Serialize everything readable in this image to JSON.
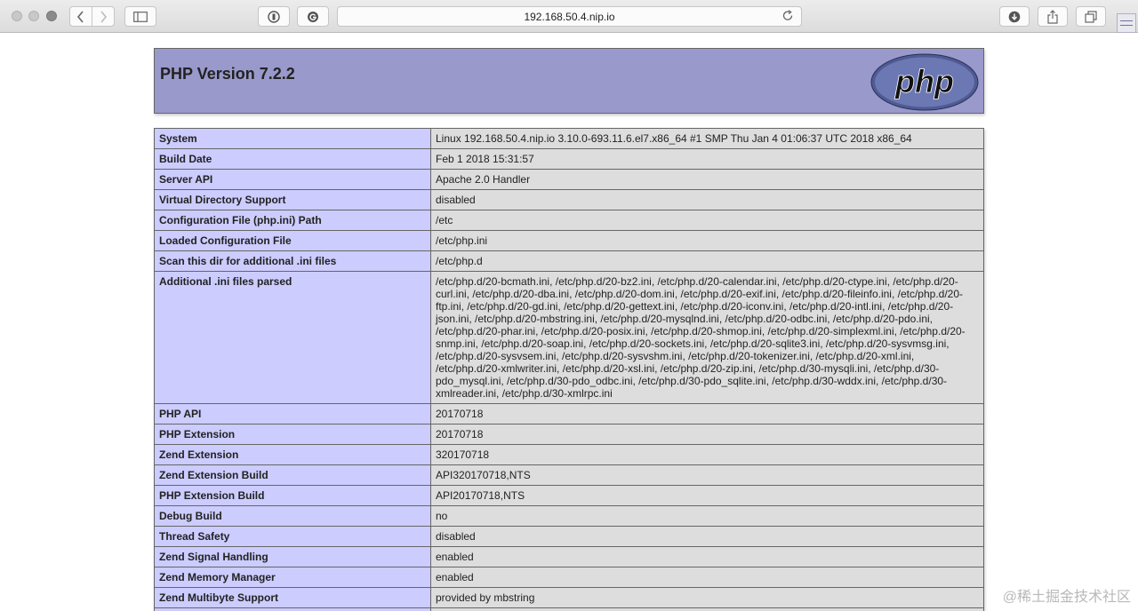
{
  "browser": {
    "url": "192.168.50.4.nip.io",
    "icons": [
      "back-icon",
      "forward-icon",
      "sidebar-icon",
      "reader-icon",
      "extension-icon",
      "reload-icon",
      "download-icon",
      "share-icon",
      "tabs-icon"
    ]
  },
  "page": {
    "title": "PHP Version 7.2.2",
    "logo_text": "php",
    "colors": {
      "header": "#9999cc",
      "label_cell": "#ccccff",
      "value_cell": "#dddddd"
    },
    "rows": [
      {
        "label": "System",
        "value": "Linux 192.168.50.4.nip.io 3.10.0-693.11.6.el7.x86_64 #1 SMP Thu Jan 4 01:06:37 UTC 2018 x86_64"
      },
      {
        "label": "Build Date",
        "value": "Feb 1 2018 15:31:57"
      },
      {
        "label": "Server API",
        "value": "Apache 2.0 Handler"
      },
      {
        "label": "Virtual Directory Support",
        "value": "disabled"
      },
      {
        "label": "Configuration File (php.ini) Path",
        "value": "/etc"
      },
      {
        "label": "Loaded Configuration File",
        "value": "/etc/php.ini"
      },
      {
        "label": "Scan this dir for additional .ini files",
        "value": "/etc/php.d"
      },
      {
        "label": "Additional .ini files parsed",
        "value": "/etc/php.d/20-bcmath.ini, /etc/php.d/20-bz2.ini, /etc/php.d/20-calendar.ini, /etc/php.d/20-ctype.ini, /etc/php.d/20-curl.ini, /etc/php.d/20-dba.ini, /etc/php.d/20-dom.ini, /etc/php.d/20-exif.ini, /etc/php.d/20-fileinfo.ini, /etc/php.d/20-ftp.ini, /etc/php.d/20-gd.ini, /etc/php.d/20-gettext.ini, /etc/php.d/20-iconv.ini, /etc/php.d/20-intl.ini, /etc/php.d/20-json.ini, /etc/php.d/20-mbstring.ini, /etc/php.d/20-mysqlnd.ini, /etc/php.d/20-odbc.ini, /etc/php.d/20-pdo.ini, /etc/php.d/20-phar.ini, /etc/php.d/20-posix.ini, /etc/php.d/20-shmop.ini, /etc/php.d/20-simplexml.ini, /etc/php.d/20-snmp.ini, /etc/php.d/20-soap.ini, /etc/php.d/20-sockets.ini, /etc/php.d/20-sqlite3.ini, /etc/php.d/20-sysvmsg.ini, /etc/php.d/20-sysvsem.ini, /etc/php.d/20-sysvshm.ini, /etc/php.d/20-tokenizer.ini, /etc/php.d/20-xml.ini, /etc/php.d/20-xmlwriter.ini, /etc/php.d/20-xsl.ini, /etc/php.d/20-zip.ini, /etc/php.d/30-mysqli.ini, /etc/php.d/30-pdo_mysql.ini, /etc/php.d/30-pdo_odbc.ini, /etc/php.d/30-pdo_sqlite.ini, /etc/php.d/30-wddx.ini, /etc/php.d/30-xmlreader.ini, /etc/php.d/30-xmlrpc.ini"
      },
      {
        "label": "PHP API",
        "value": "20170718"
      },
      {
        "label": "PHP Extension",
        "value": "20170718"
      },
      {
        "label": "Zend Extension",
        "value": "320170718"
      },
      {
        "label": "Zend Extension Build",
        "value": "API320170718,NTS"
      },
      {
        "label": "PHP Extension Build",
        "value": "API20170718,NTS"
      },
      {
        "label": "Debug Build",
        "value": "no"
      },
      {
        "label": "Thread Safety",
        "value": "disabled"
      },
      {
        "label": "Zend Signal Handling",
        "value": "enabled"
      },
      {
        "label": "Zend Memory Manager",
        "value": "enabled"
      },
      {
        "label": "Zend Multibyte Support",
        "value": "provided by mbstring"
      },
      {
        "label": "",
        "value": ""
      }
    ]
  },
  "watermark": "@稀土掘金技术社区"
}
